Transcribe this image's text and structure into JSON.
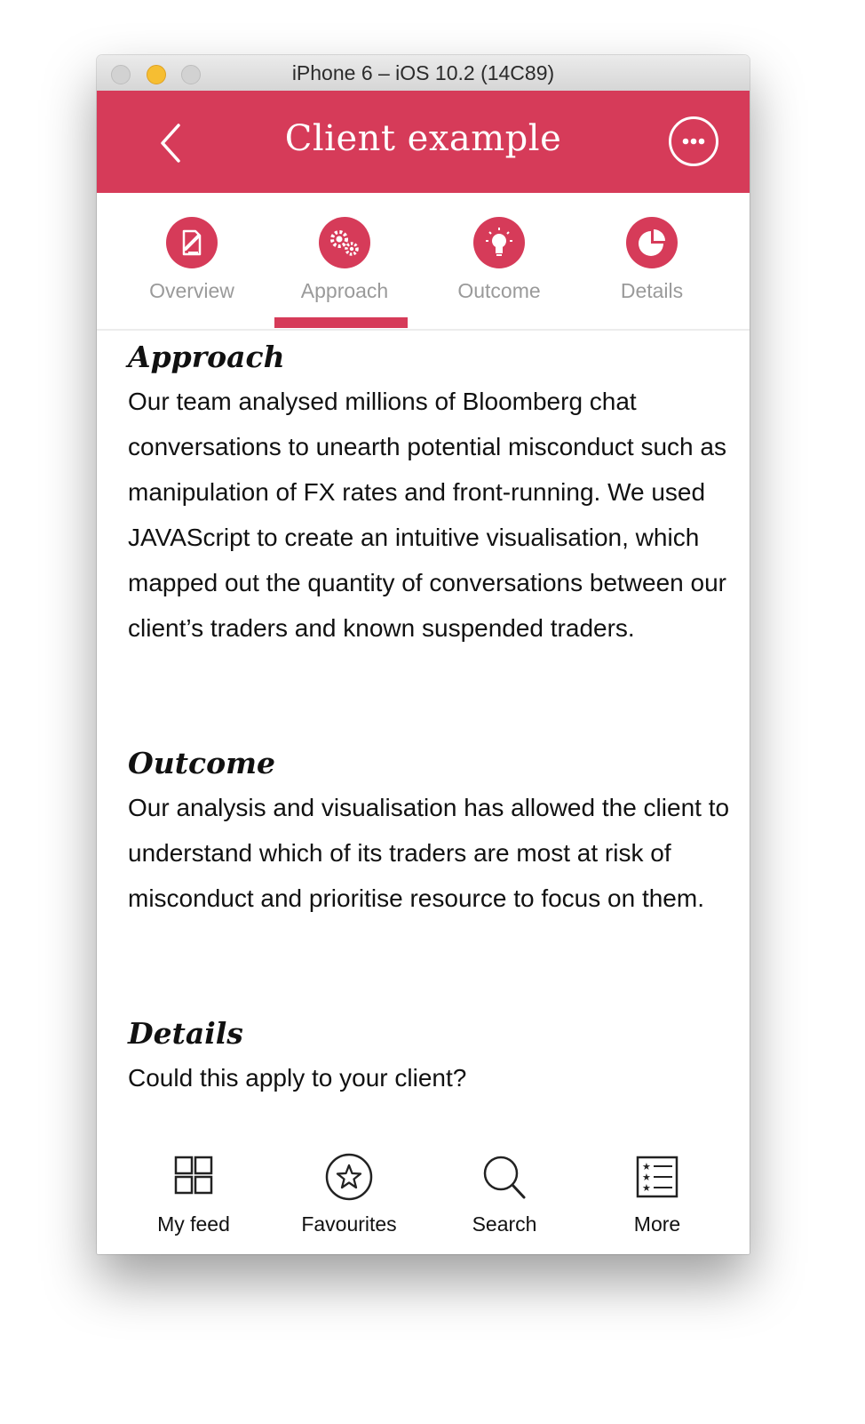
{
  "window": {
    "title": "iPhone 6 – iOS 10.2 (14C89)"
  },
  "navbar": {
    "title": "Client example",
    "back_icon": "chevron-left-icon",
    "more_icon": "ellipsis-circle-icon",
    "background_color": "#d63b59"
  },
  "tabs": [
    {
      "label": "Overview",
      "icon": "document-pen-icon"
    },
    {
      "label": "Approach",
      "icon": "gears-icon"
    },
    {
      "label": "Outcome",
      "icon": "lightbulb-icon"
    },
    {
      "label": "Details",
      "icon": "pie-chart-icon"
    }
  ],
  "active_tab": "Approach",
  "sections": {
    "approach": {
      "heading": "Approach",
      "body": "Our team analysed millions of Bloomberg chat conversations to unearth potential misconduct such as manipulation of FX rates and front-running. We used JAVAScript to create an intuitive visualisation, which mapped out the quantity of conversations between our client’s traders and known suspended traders."
    },
    "outcome": {
      "heading": "Outcome",
      "body": "Our analysis and visualisation has allowed the client to understand which of its traders are most at risk of misconduct and prioritise resource to focus on them."
    },
    "details": {
      "heading": "Details",
      "body": "Could this apply to your client?"
    }
  },
  "bottom_nav": [
    {
      "label": "My feed",
      "icon": "grid-icon"
    },
    {
      "label": "Favourites",
      "icon": "star-circle-icon"
    },
    {
      "label": "Search",
      "icon": "search-icon"
    },
    {
      "label": "More",
      "icon": "list-icon"
    }
  ],
  "accent_color": "#d63b59"
}
